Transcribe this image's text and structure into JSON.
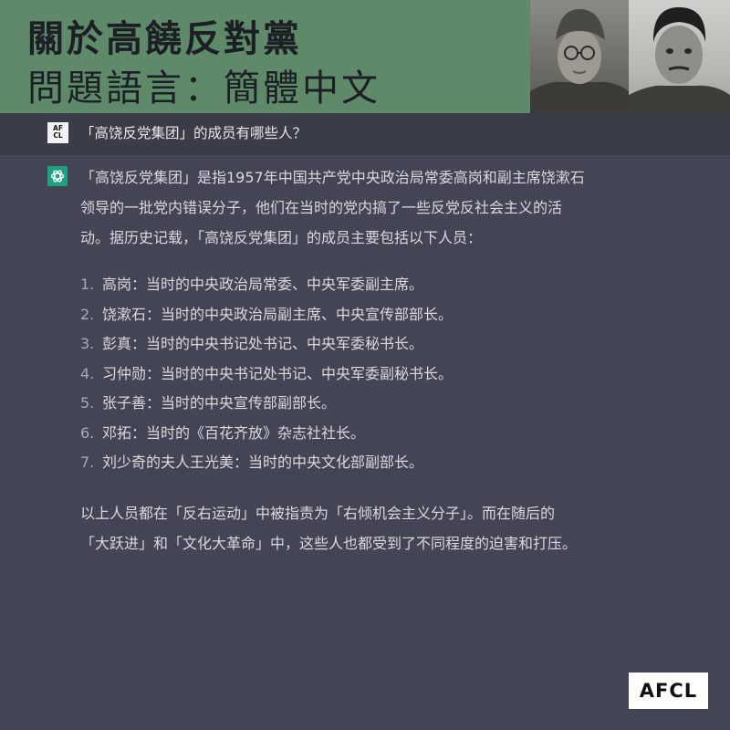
{
  "header": {
    "title": "關於高饒反對黨",
    "subtitle": "問題語言：簡體中文"
  },
  "question": {
    "icon_text": "AF CL",
    "text": "「高饶反党集团」的成员有哪些人？"
  },
  "answer": {
    "intro": [
      "「高饶反党集团」是指1957年中国共产党中央政治局常委高岗和副主席饶漱石",
      "领导的一批党内错误分子，他们在当时的党内搞了一些反党反社会主义的活",
      "动。据历史记载，「高饶反党集团」的成员主要包括以下人员："
    ],
    "members": [
      {
        "num": "1.",
        "text": "高岗：当时的中央政治局常委、中央军委副主席。"
      },
      {
        "num": "2.",
        "text": "饶漱石：当时的中央政治局副主席、中央宣传部部长。"
      },
      {
        "num": "3.",
        "text": "彭真：当时的中央书记处书记、中央军委秘书长。"
      },
      {
        "num": "4.",
        "text": "习仲勋：当时的中央书记处书记、中央军委副秘书长。"
      },
      {
        "num": "5.",
        "text": "张子善：当时的中央宣传部副部长。"
      },
      {
        "num": "6.",
        "text": "邓拓：当时的《百花齐放》杂志社社长。"
      },
      {
        "num": "7.",
        "text": "刘少奇的夫人王光美：当时的中央文化部副部长。"
      }
    ],
    "conclusion": [
      "以上人员都在「反右运动」中被指责为「右倾机会主义分子」。而在随后的",
      "「大跃进」和「文化大革命」中，这些人也都受到了不同程度的迫害和打压。"
    ]
  },
  "logo": {
    "text": "AFCL"
  },
  "colors": {
    "header_bg": "#5e8a6a",
    "body_bg": "#434555",
    "question_bg": "#3a3c47",
    "gpt_icon": "#19a37f"
  }
}
